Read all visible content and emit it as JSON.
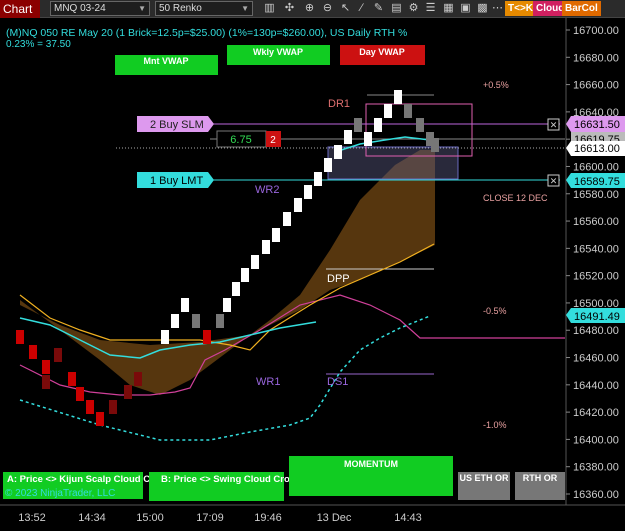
{
  "toolbar": {
    "chart_label": "Chart",
    "instrument": "MNQ 03-24",
    "period": "50 Renko",
    "badges": {
      "tk": "T<>K",
      "cloud": "Cloud",
      "barcol": "BarCol"
    }
  },
  "header": {
    "title": "(M)NQ 050 RE May 20 (1 Brick=12.5p=$25.00) (1%=130p=$260.00), US Daily RTH %",
    "subtitle": "0.23% = 37.50"
  },
  "vwap_buttons": {
    "monthly": "Mnt VWAP",
    "weekly": "Wkly VWAP",
    "daily": "Day VWAP"
  },
  "orders": {
    "stop": {
      "label": "2 Buy SLM",
      "price": "16631.50"
    },
    "limit": {
      "label": "1 Buy LMT",
      "price": "16589.75"
    },
    "position_value": "6.75",
    "position_qty": "2"
  },
  "price_labels": {
    "last": "16613.00",
    "bid": "16619.75",
    "level": "16491.49"
  },
  "level_labels": {
    "dr1": "DR1",
    "wr2": "WR2",
    "dpp": "DPP",
    "wr1": "WR1",
    "ds1": "DS1",
    "close": "CLOSE 12 DEC"
  },
  "pct_labels": {
    "p05": "+0.5%",
    "m05": "-0.5%",
    "m10": "-1.0%"
  },
  "bottom_buttons": {
    "kijun": "A: Price <> Kijun Scalp Cloud Cross",
    "swing": "B: Price <> Swing Cloud Cross",
    "momentum": "MOMENTUM",
    "us_eth": "US ETH OR",
    "rth": "RTH OR"
  },
  "copyright": "© 2023 NinjaTrader, LLC",
  "price_axis": [
    "16700.00",
    "16680.00",
    "16660.00",
    "16640.00",
    "16620.00",
    "16600.00",
    "16580.00",
    "16560.00",
    "16540.00",
    "16520.00",
    "16500.00",
    "16480.00",
    "16460.00",
    "16440.00",
    "16420.00",
    "16400.00",
    "16380.00",
    "16360.00"
  ],
  "time_axis": [
    "13:52",
    "14:34",
    "15:00",
    "17:09",
    "19:46",
    "13 Dec",
    "14:43"
  ],
  "colors": {
    "up": "#ffffff",
    "down": "#cc0000",
    "down_dark": "#7a0a0a",
    "neutral": "#777777",
    "cyan": "#33dddd",
    "orange": "#f0b020",
    "pink": "#e0509a",
    "green_btn": "#11cc22",
    "red_btn": "#cc1111"
  }
}
